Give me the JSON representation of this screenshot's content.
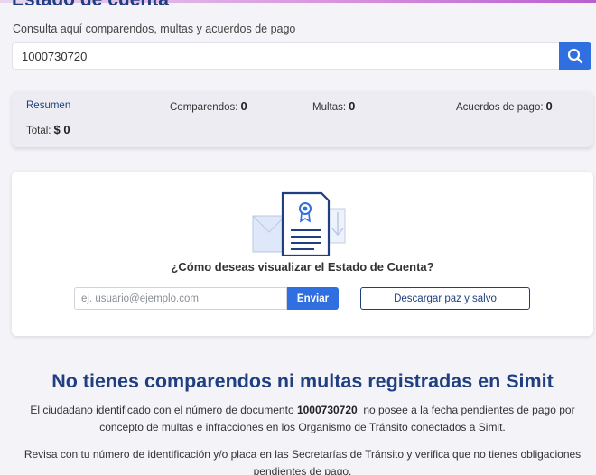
{
  "header": {
    "title": "Estado de cuenta",
    "subtitle": "Consulta aquí comparendos, multas y acuerdos de pago"
  },
  "search": {
    "value": "1000730720",
    "button_icon": "search-icon"
  },
  "summary": {
    "tab_label": "Resumen",
    "comparendos_label": "Comparendos:",
    "comparendos_value": "0",
    "multas_label": "Multas:",
    "multas_value": "0",
    "acuerdos_label": "Acuerdos de pago:",
    "acuerdos_value": "0",
    "total_label": "Total:",
    "total_value": "$ 0"
  },
  "view_options": {
    "illustration_icon": "document-certificate-icon",
    "question": "¿Cómo deseas visualizar el Estado de Cuenta?",
    "email_placeholder": "ej. usuario@ejemplo.com",
    "send_label": "Enviar",
    "download_label": "Descargar paz y salvo"
  },
  "result": {
    "heading": "No tienes comparendos ni multas registradas en Simit",
    "text_before": "El ciudadano identificado con el número de documento ",
    "document_number": "1000730720",
    "text_after": ", no posee a la fecha pendientes de pago por concepto de multas e infracciones en los Organismo de Tránsito conectados a Simit.",
    "check_text": "Revisa con tu número de identificación y/o placa en las Secretarías de Tránsito y verifica que no tienes obligaciones pendientes de pago."
  },
  "colors": {
    "primary_blue": "#2f6fdf",
    "title_navy": "#1f3f80",
    "background": "#f4f4f8"
  }
}
